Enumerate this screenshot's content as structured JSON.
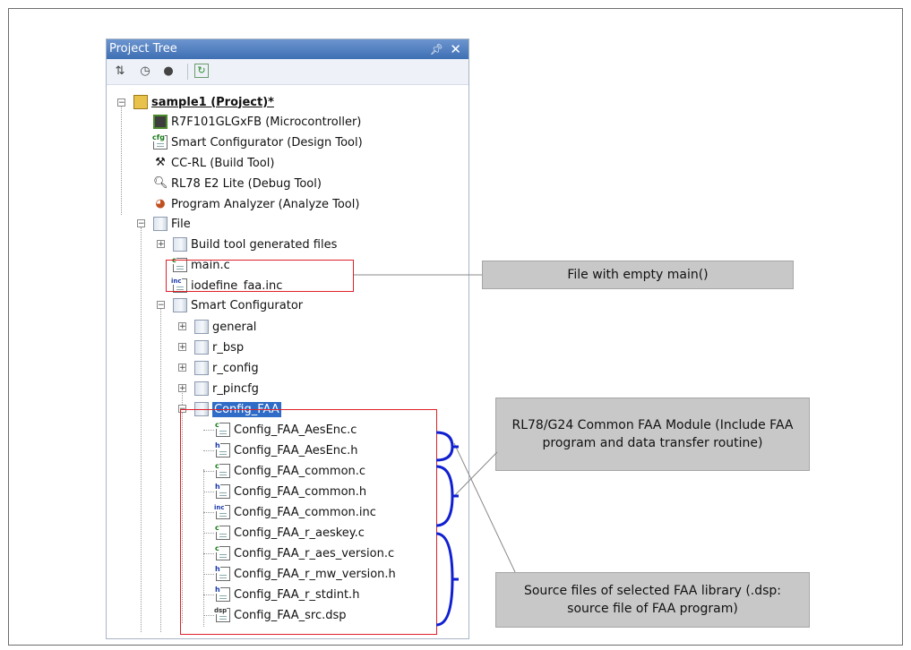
{
  "panel": {
    "title": "Project Tree",
    "pin_icon": "pin-icon",
    "close_icon": "close-icon"
  },
  "toolbar": {
    "buttons": [
      "sort-icon",
      "clock-icon",
      "user-icon",
      "refresh-icon"
    ]
  },
  "tree": {
    "project": "sample1 (Project)*",
    "microcontroller": "R7F101GLGxFB (Microcontroller)",
    "design_tool": "Smart Configurator (Design Tool)",
    "build_tool": "CC-RL (Build Tool)",
    "debug_tool": "RL78 E2 Lite (Debug Tool)",
    "analyze_tool": "Program Analyzer (Analyze Tool)",
    "file_folder": "File",
    "build_generated": "Build tool generated files",
    "main_c": "main.c",
    "iodefine": "iodefine_faa.inc",
    "smart_configurator": "Smart Configurator",
    "general": "general",
    "r_bsp": "r_bsp",
    "r_config": "r_config",
    "r_pincfg": "r_pincfg",
    "config_faa": "Config_FAA",
    "faa_files": [
      {
        "name": "Config_FAA_AesEnc.c",
        "type": "c"
      },
      {
        "name": "Config_FAA_AesEnc.h",
        "type": "h"
      },
      {
        "name": "Config_FAA_common.c",
        "type": "c"
      },
      {
        "name": "Config_FAA_common.h",
        "type": "h"
      },
      {
        "name": "Config_FAA_common.inc",
        "type": "inc"
      },
      {
        "name": "Config_FAA_r_aeskey.c",
        "type": "c"
      },
      {
        "name": "Config_FAA_r_aes_version.c",
        "type": "c"
      },
      {
        "name": "Config_FAA_r_mw_version.h",
        "type": "h"
      },
      {
        "name": "Config_FAA_r_stdint.h",
        "type": "h"
      },
      {
        "name": "Config_FAA_src.dsp",
        "type": "dsp"
      }
    ]
  },
  "callouts": {
    "main": "File with empty main()",
    "module": "RL78/G24 Common FAA Module (Include FAA program and data transfer routine)",
    "source": "Source files of selected FAA library (.dsp: source file of FAA program)"
  },
  "colors": {
    "highlight_box": "#e0202a",
    "brace": "#1020d0",
    "selection": "#2f6cc7",
    "titlebar": "#4f7fc0"
  }
}
